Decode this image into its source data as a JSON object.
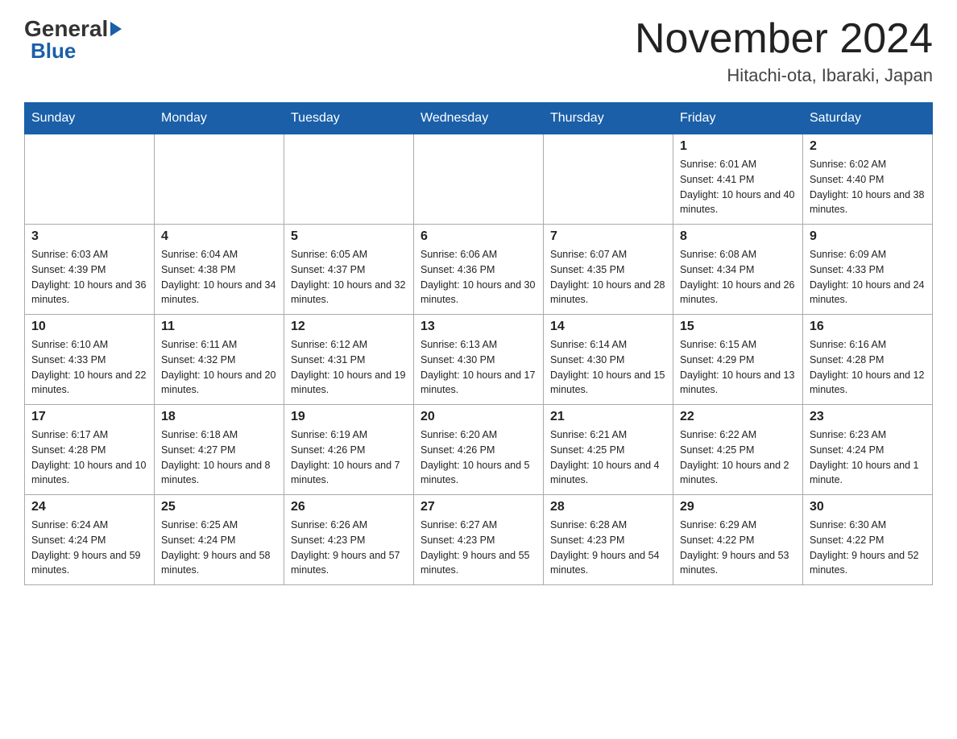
{
  "header": {
    "logo_general": "General",
    "logo_blue": "Blue",
    "month_year": "November 2024",
    "location": "Hitachi-ota, Ibaraki, Japan"
  },
  "days_of_week": [
    "Sunday",
    "Monday",
    "Tuesday",
    "Wednesday",
    "Thursday",
    "Friday",
    "Saturday"
  ],
  "weeks": [
    [
      {
        "day": "",
        "info": ""
      },
      {
        "day": "",
        "info": ""
      },
      {
        "day": "",
        "info": ""
      },
      {
        "day": "",
        "info": ""
      },
      {
        "day": "",
        "info": ""
      },
      {
        "day": "1",
        "info": "Sunrise: 6:01 AM\nSunset: 4:41 PM\nDaylight: 10 hours and 40 minutes."
      },
      {
        "day": "2",
        "info": "Sunrise: 6:02 AM\nSunset: 4:40 PM\nDaylight: 10 hours and 38 minutes."
      }
    ],
    [
      {
        "day": "3",
        "info": "Sunrise: 6:03 AM\nSunset: 4:39 PM\nDaylight: 10 hours and 36 minutes."
      },
      {
        "day": "4",
        "info": "Sunrise: 6:04 AM\nSunset: 4:38 PM\nDaylight: 10 hours and 34 minutes."
      },
      {
        "day": "5",
        "info": "Sunrise: 6:05 AM\nSunset: 4:37 PM\nDaylight: 10 hours and 32 minutes."
      },
      {
        "day": "6",
        "info": "Sunrise: 6:06 AM\nSunset: 4:36 PM\nDaylight: 10 hours and 30 minutes."
      },
      {
        "day": "7",
        "info": "Sunrise: 6:07 AM\nSunset: 4:35 PM\nDaylight: 10 hours and 28 minutes."
      },
      {
        "day": "8",
        "info": "Sunrise: 6:08 AM\nSunset: 4:34 PM\nDaylight: 10 hours and 26 minutes."
      },
      {
        "day": "9",
        "info": "Sunrise: 6:09 AM\nSunset: 4:33 PM\nDaylight: 10 hours and 24 minutes."
      }
    ],
    [
      {
        "day": "10",
        "info": "Sunrise: 6:10 AM\nSunset: 4:33 PM\nDaylight: 10 hours and 22 minutes."
      },
      {
        "day": "11",
        "info": "Sunrise: 6:11 AM\nSunset: 4:32 PM\nDaylight: 10 hours and 20 minutes."
      },
      {
        "day": "12",
        "info": "Sunrise: 6:12 AM\nSunset: 4:31 PM\nDaylight: 10 hours and 19 minutes."
      },
      {
        "day": "13",
        "info": "Sunrise: 6:13 AM\nSunset: 4:30 PM\nDaylight: 10 hours and 17 minutes."
      },
      {
        "day": "14",
        "info": "Sunrise: 6:14 AM\nSunset: 4:30 PM\nDaylight: 10 hours and 15 minutes."
      },
      {
        "day": "15",
        "info": "Sunrise: 6:15 AM\nSunset: 4:29 PM\nDaylight: 10 hours and 13 minutes."
      },
      {
        "day": "16",
        "info": "Sunrise: 6:16 AM\nSunset: 4:28 PM\nDaylight: 10 hours and 12 minutes."
      }
    ],
    [
      {
        "day": "17",
        "info": "Sunrise: 6:17 AM\nSunset: 4:28 PM\nDaylight: 10 hours and 10 minutes."
      },
      {
        "day": "18",
        "info": "Sunrise: 6:18 AM\nSunset: 4:27 PM\nDaylight: 10 hours and 8 minutes."
      },
      {
        "day": "19",
        "info": "Sunrise: 6:19 AM\nSunset: 4:26 PM\nDaylight: 10 hours and 7 minutes."
      },
      {
        "day": "20",
        "info": "Sunrise: 6:20 AM\nSunset: 4:26 PM\nDaylight: 10 hours and 5 minutes."
      },
      {
        "day": "21",
        "info": "Sunrise: 6:21 AM\nSunset: 4:25 PM\nDaylight: 10 hours and 4 minutes."
      },
      {
        "day": "22",
        "info": "Sunrise: 6:22 AM\nSunset: 4:25 PM\nDaylight: 10 hours and 2 minutes."
      },
      {
        "day": "23",
        "info": "Sunrise: 6:23 AM\nSunset: 4:24 PM\nDaylight: 10 hours and 1 minute."
      }
    ],
    [
      {
        "day": "24",
        "info": "Sunrise: 6:24 AM\nSunset: 4:24 PM\nDaylight: 9 hours and 59 minutes."
      },
      {
        "day": "25",
        "info": "Sunrise: 6:25 AM\nSunset: 4:24 PM\nDaylight: 9 hours and 58 minutes."
      },
      {
        "day": "26",
        "info": "Sunrise: 6:26 AM\nSunset: 4:23 PM\nDaylight: 9 hours and 57 minutes."
      },
      {
        "day": "27",
        "info": "Sunrise: 6:27 AM\nSunset: 4:23 PM\nDaylight: 9 hours and 55 minutes."
      },
      {
        "day": "28",
        "info": "Sunrise: 6:28 AM\nSunset: 4:23 PM\nDaylight: 9 hours and 54 minutes."
      },
      {
        "day": "29",
        "info": "Sunrise: 6:29 AM\nSunset: 4:22 PM\nDaylight: 9 hours and 53 minutes."
      },
      {
        "day": "30",
        "info": "Sunrise: 6:30 AM\nSunset: 4:22 PM\nDaylight: 9 hours and 52 minutes."
      }
    ]
  ]
}
